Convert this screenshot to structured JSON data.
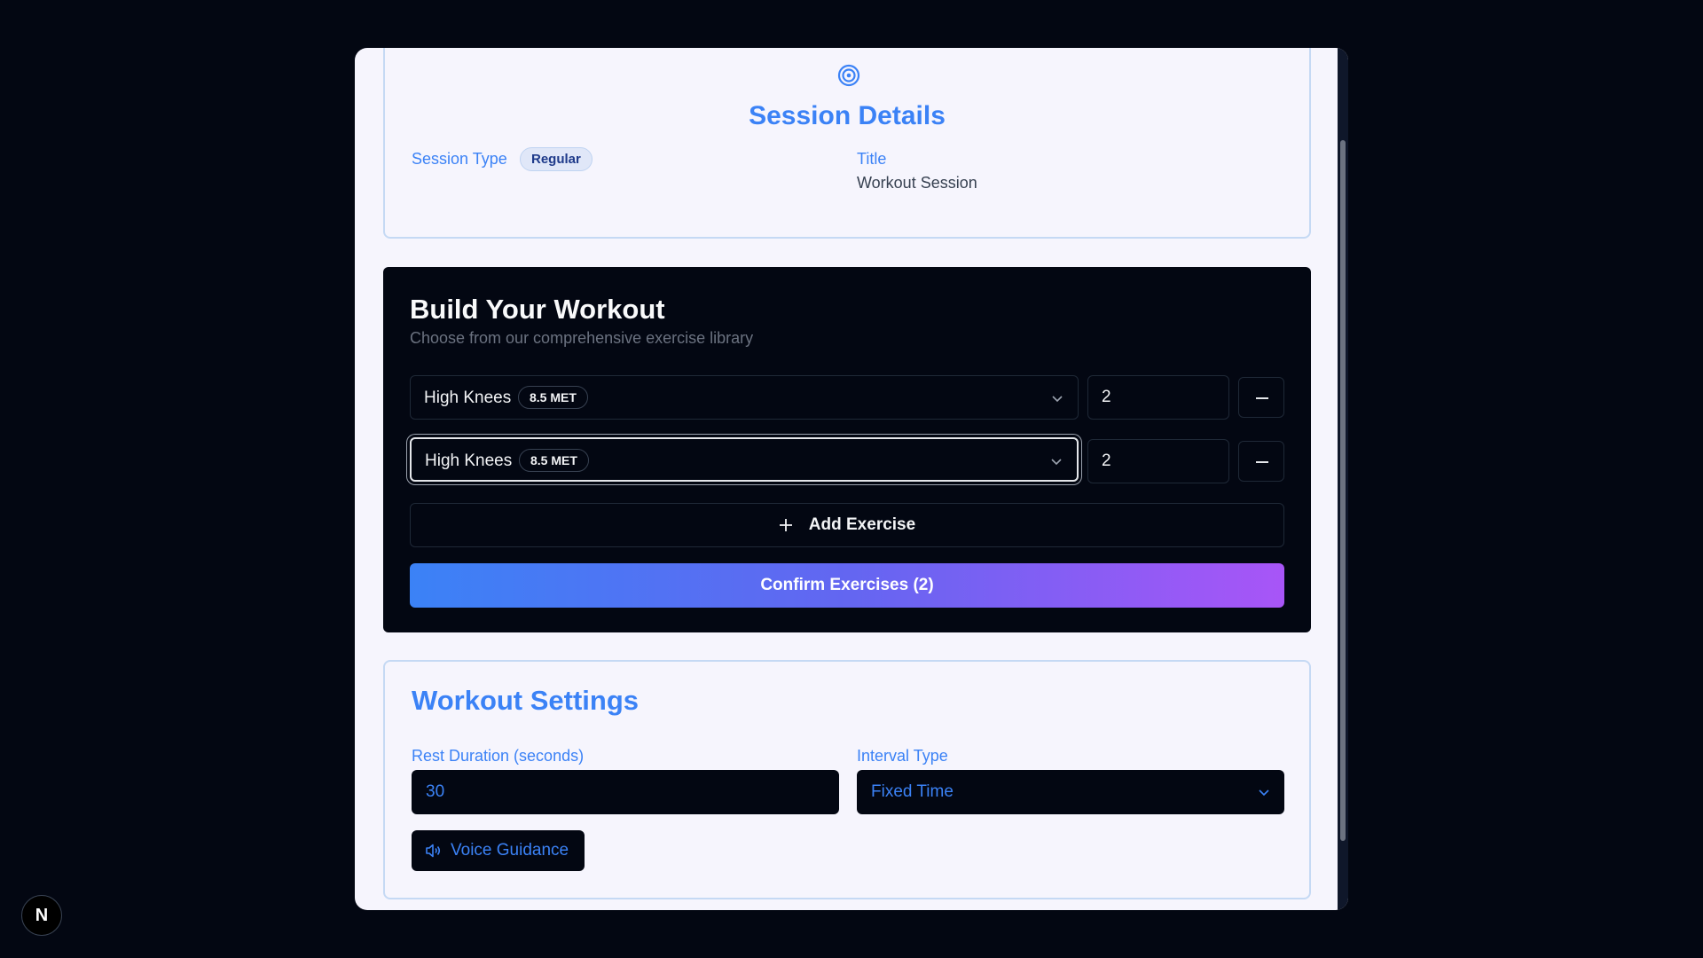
{
  "session": {
    "heading": "Session Details",
    "type_label": "Session Type",
    "type_value": "Regular",
    "title_label": "Title",
    "title_value": "Workout Session"
  },
  "builder": {
    "heading": "Build Your Workout",
    "subtitle": "Choose from our comprehensive exercise library",
    "exercises": [
      {
        "name": "High Knees",
        "met": "8.5 MET",
        "quantity": "2"
      },
      {
        "name": "High Knees",
        "met": "8.5 MET",
        "quantity": "2"
      }
    ],
    "add_label": "Add Exercise",
    "confirm_label": "Confirm Exercises (2)"
  },
  "settings": {
    "heading": "Workout Settings",
    "rest_label": "Rest Duration (seconds)",
    "rest_value": "30",
    "interval_label": "Interval Type",
    "interval_value": "Fixed Time",
    "voice_label": "Voice Guidance"
  },
  "logo": {
    "letter": "N"
  },
  "colors": {
    "accent": "#3b82f6",
    "gradient_start": "#3b82f6",
    "gradient_end": "#a855f7",
    "background": "#030712",
    "panel": "#f6f5fd"
  },
  "icons": {
    "session": "target-icon",
    "select": "chevron-down-icon",
    "remove": "minus-icon",
    "add": "plus-icon",
    "voice": "speaker-icon"
  }
}
